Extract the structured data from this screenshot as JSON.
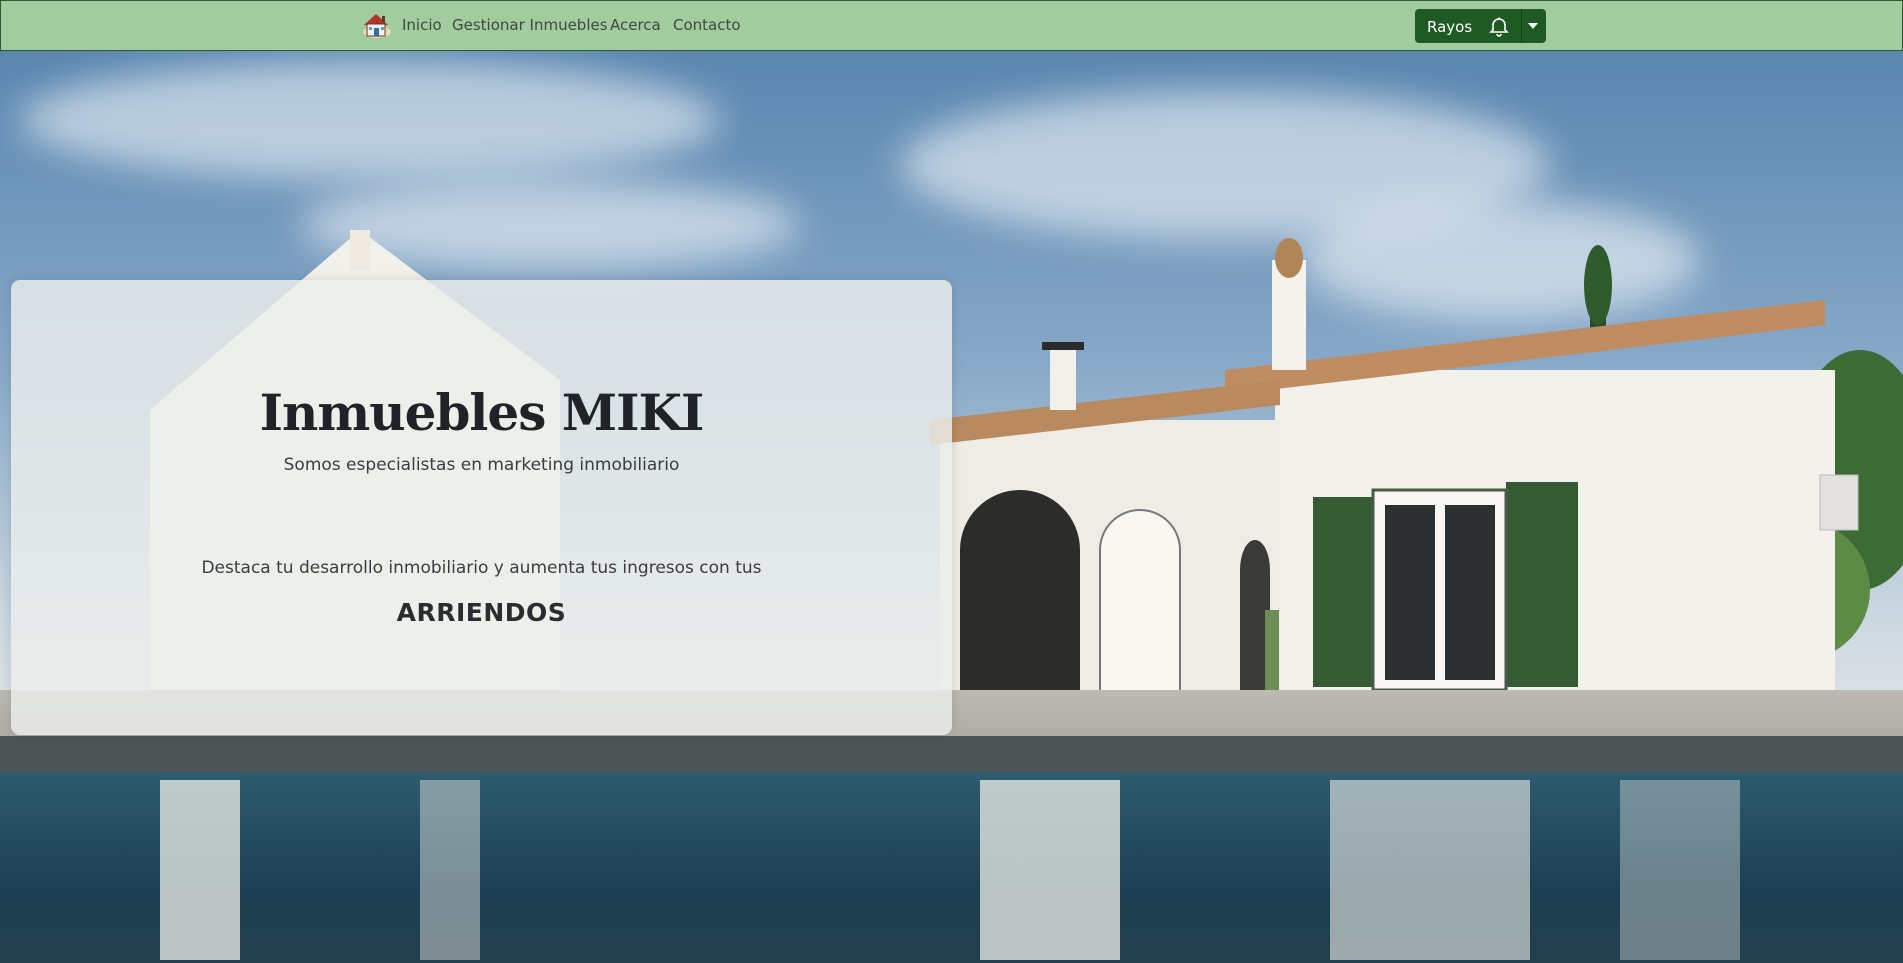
{
  "nav": {
    "brand_icon": "house-logo-icon",
    "links": [
      {
        "label": "Inicio"
      },
      {
        "label": "Gestionar Inmuebles"
      },
      {
        "label": "Acerca"
      },
      {
        "label": "Contacto"
      }
    ],
    "user": {
      "name": "Rayos",
      "bell_icon": "bell-icon",
      "toggle_icon": "caret-down-icon"
    }
  },
  "hero": {
    "title": "Inmuebles MIKI",
    "subtitle": "Somos especialistas en marketing inmobiliario",
    "text": "Destaca tu desarrollo inmobiliario y aumenta tus ingresos con tus",
    "highlight": "ARRIENDOS",
    "background": "house-with-pool-photo"
  },
  "colors": {
    "navbar_bg": "#a2cb9f",
    "button_bg": "#1f5a24"
  }
}
